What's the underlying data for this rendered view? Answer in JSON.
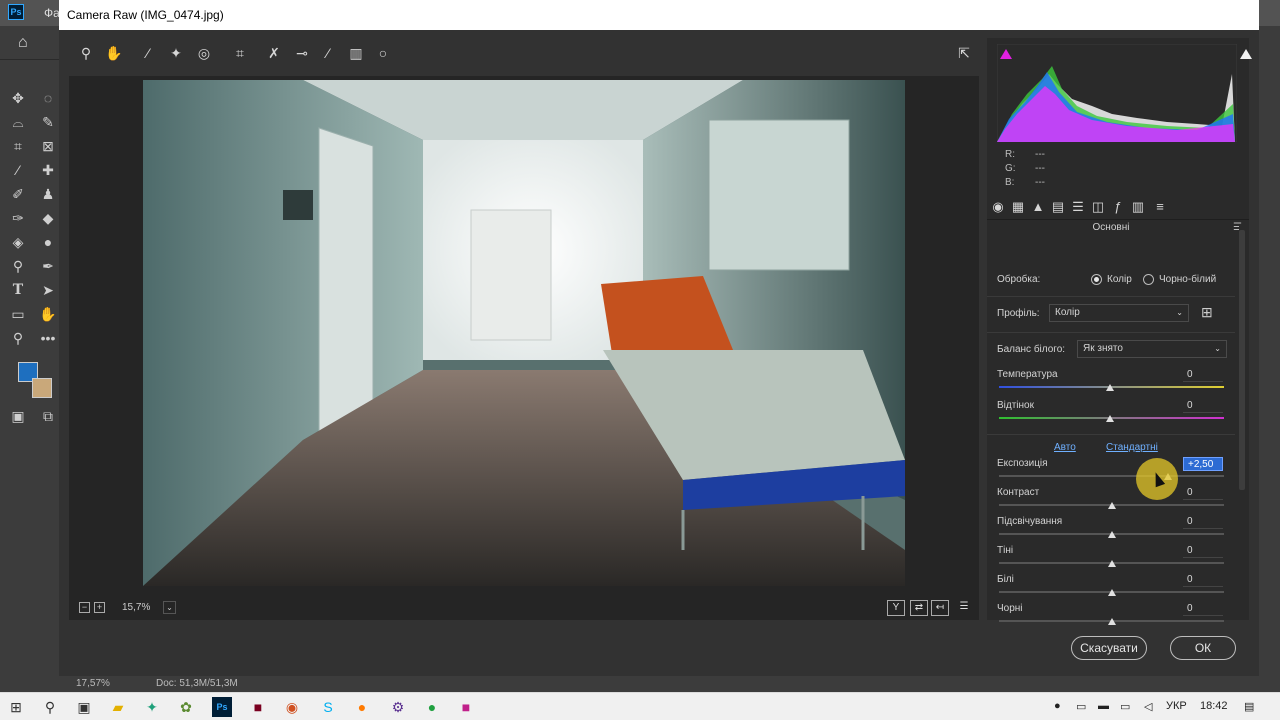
{
  "photoshop": {
    "menu_first_item": "Фа",
    "status_zoom": "17,57%",
    "status_doc": "Doc: 51,3M/51,3M"
  },
  "camera_raw": {
    "title": "Camera Raw (IMG_0474.jpg)",
    "zoom_value": "15,7%",
    "panel": {
      "rgb": {
        "r_label": "R:",
        "g_label": "G:",
        "b_label": "B:",
        "r": "---",
        "g": "---",
        "b": "---"
      },
      "section_title": "Основні",
      "treatment_label": "Обробка:",
      "treatment_options": {
        "color": "Колір",
        "bw": "Чорно-білий"
      },
      "treatment_selected": "color",
      "profile_label": "Профіль:",
      "profile_value": "Колір",
      "wb_label": "Баланс білого:",
      "wb_value": "Як знято",
      "temperature_label": "Температура",
      "temperature_value": "0",
      "tint_label": "Відтінок",
      "tint_value": "0",
      "auto_label": "Авто",
      "default_label": "Стандартні",
      "sliders": [
        {
          "label": "Експозиція",
          "value": "+2,50",
          "level": 0.75
        },
        {
          "label": "Контраст",
          "value": "0",
          "level": 0.5
        },
        {
          "label": "Підсвічування",
          "value": "0",
          "level": 0.5
        },
        {
          "label": "Тіні",
          "value": "0",
          "level": 0.5
        },
        {
          "label": "Білі",
          "value": "0",
          "level": 0.5
        },
        {
          "label": "Чорні",
          "value": "0",
          "level": 0.5
        }
      ]
    },
    "cancel_label": "Скасувати",
    "ok_label": "ОК"
  },
  "taskbar": {
    "language": "УКР",
    "time": "18:42"
  },
  "colors": {
    "foreground": "#1e6fbf",
    "background": "#c9a87a",
    "accent_highlight": "#2d6bd3",
    "cursor_halo": "#e6c828"
  }
}
